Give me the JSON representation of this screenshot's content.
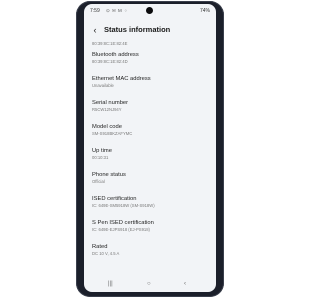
{
  "status_bar": {
    "time": "7:59",
    "icons": "⊙ ✉ M ⁘",
    "battery": "74%"
  },
  "header": {
    "back_glyph": "‹",
    "title": "Status information"
  },
  "items": [
    {
      "label": "",
      "value": "80:39:8C:1E:82:4E"
    },
    {
      "label": "Bluetooth address",
      "value": "80:39:8C:1E:82:4D"
    },
    {
      "label": "Ethernet MAC address",
      "value": "Unavailable"
    },
    {
      "label": "Serial number",
      "value": "R5CW12NJ94Y"
    },
    {
      "label": "Model code",
      "value": "SM-S918BKZAFYMC"
    },
    {
      "label": "Up time",
      "value": "00:10:31"
    },
    {
      "label": "Phone status",
      "value": "Official"
    },
    {
      "label": "ISED certification",
      "value": "IC: 649E-SM5918W (SM-S918W)"
    },
    {
      "label": "S Pen ISED certification",
      "value": "IC: 649E-EJPS918 (EJ-PS918)"
    },
    {
      "label": "Rated",
      "value": "DC 10 V, 4.5 A"
    }
  ],
  "nav": {
    "recent": "|||",
    "home": "○",
    "back": "‹"
  }
}
